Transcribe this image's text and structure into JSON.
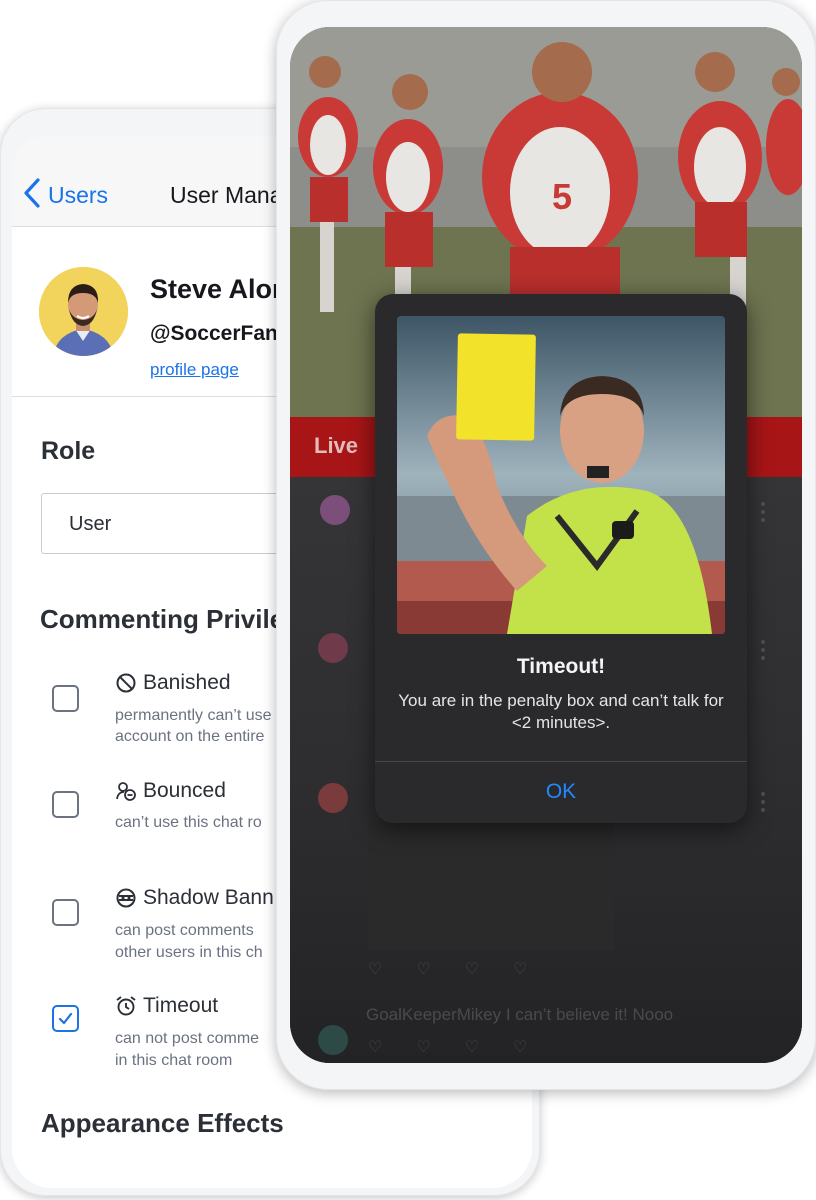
{
  "admin": {
    "nav": {
      "back_label": "Users",
      "title": "User Management"
    },
    "user": {
      "name": "Steve Alonso",
      "handle": "@SoccerFan",
      "profile_link": "profile page"
    },
    "role": {
      "heading": "Role",
      "value": "User"
    },
    "commenting": {
      "heading": "Commenting Privileges",
      "items": [
        {
          "icon": "ban-icon",
          "title": "Banished",
          "desc_lines": [
            "permanently can’t use",
            "account on the entire"
          ],
          "checked": false
        },
        {
          "icon": "user-minus-icon",
          "title": "Bounced",
          "desc_lines": [
            "can’t use this chat ro"
          ],
          "checked": false
        },
        {
          "icon": "shadow-ban-icon",
          "title": "Shadow Bann",
          "desc_lines": [
            "can post comments",
            "other users in this ch"
          ],
          "checked": false
        },
        {
          "icon": "alarm-clock-icon",
          "title": "Timeout",
          "desc_lines": [
            "can not post comme",
            "in this chat room"
          ],
          "checked": true
        }
      ]
    },
    "appearance": {
      "heading": "Appearance Effects"
    }
  },
  "chat": {
    "live_bar_label": "Live",
    "faded_comment_user": "GoalKeeperMikey",
    "faded_comment_text": "I can’t believe it! Nooo"
  },
  "alert": {
    "image": "referee-yellow-card",
    "title": "Timeout!",
    "message": "You are in the penalty box and can’t talk for <2 minutes>.",
    "button_label": "OK"
  },
  "colors": {
    "accent": "#1a73e8",
    "alert_button": "#1f8bff",
    "live_bar": "#a81517",
    "avatar_bg": "#f2d35b"
  }
}
